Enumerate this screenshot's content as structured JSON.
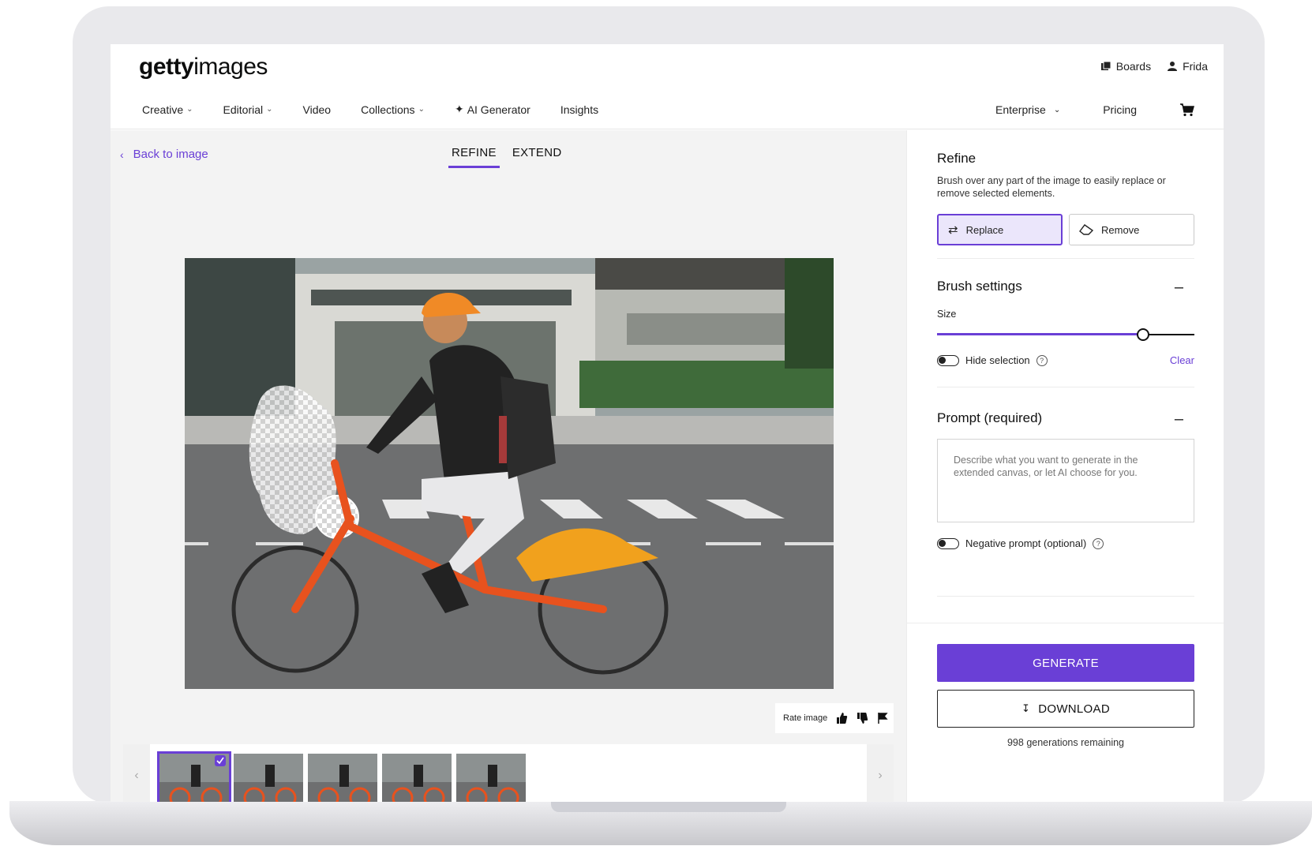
{
  "brand": {
    "logo_bold": "getty",
    "logo_light": "images"
  },
  "top_right": {
    "boards": "Boards",
    "user": "Frida"
  },
  "nav": {
    "items": [
      {
        "label": "Creative",
        "dropdown": true
      },
      {
        "label": "Editorial",
        "dropdown": true
      },
      {
        "label": "Video",
        "dropdown": false
      },
      {
        "label": "Collections",
        "dropdown": true
      },
      {
        "label": "AI Generator",
        "dropdown": false
      },
      {
        "label": "Insights",
        "dropdown": false
      }
    ],
    "enterprise": "Enterprise",
    "pricing": "Pricing"
  },
  "editor": {
    "back": "Back to image",
    "tabs": [
      {
        "label": "REFINE",
        "active": true
      },
      {
        "label": "EXTEND",
        "active": false
      }
    ],
    "rate_label": "Rate image"
  },
  "panel": {
    "refine_title": "Refine",
    "refine_desc": "Brush over any part of the image to easily replace or remove selected elements.",
    "replace_label": "Replace",
    "remove_label": "Remove",
    "brush_title": "Brush settings",
    "size_label": "Size",
    "brush_size_fraction": 0.8,
    "hide_selection": "Hide selection",
    "clear": "Clear",
    "prompt_title": "Prompt (required)",
    "prompt_placeholder": "Describe what you want to generate in the extended canvas, or let AI choose for you.",
    "negative_prompt": "Negative prompt (optional)",
    "generate": "GENERATE",
    "download": "DOWNLOAD",
    "remaining": "998 generations remaining"
  },
  "colors": {
    "accent": "#6a3fd6"
  }
}
